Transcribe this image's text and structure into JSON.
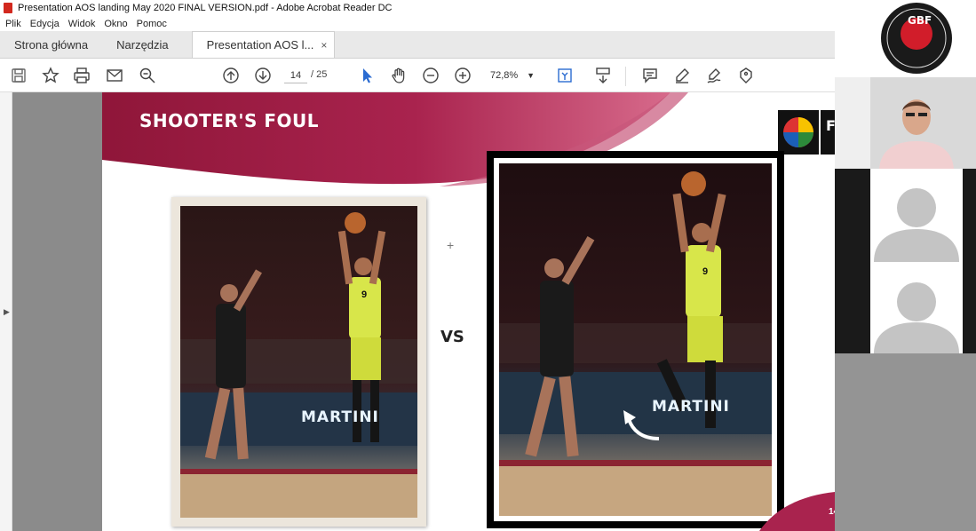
{
  "window": {
    "title": "Presentation AOS  landing May 2020 FINAL VERSION.pdf - Adobe Acrobat Reader DC"
  },
  "menu": [
    "Plik",
    "Edycja",
    "Widok",
    "Okno",
    "Pomoc"
  ],
  "tabs": [
    {
      "label": "Strona główna"
    },
    {
      "label": "Narzędzia"
    },
    {
      "label": "Presentation AOS  l...",
      "active": true,
      "close": "×"
    }
  ],
  "toolbar": {
    "page_current": "14",
    "page_total": "/ 25",
    "zoom": "72,8%",
    "icons": [
      "save-icon",
      "star-icon",
      "print-icon",
      "mail-icon",
      "search-zoom-icon",
      "page-up-icon",
      "page-down-icon",
      "select-arrow-icon",
      "hand-icon",
      "zoom-out-icon",
      "zoom-in-icon",
      "fit-page-icon",
      "scroll-mode-icon",
      "comment-icon",
      "highlight-icon",
      "sign-icon",
      "stamp-icon"
    ]
  },
  "slide": {
    "title": "SHOOTER'S FOUL",
    "vs": "VS",
    "page_number": "14",
    "logo_letter": "F",
    "colors": {
      "banner": "#9b1b43",
      "banner_light": "#c03a64"
    }
  },
  "left_photo": {
    "brand": "MARTINI",
    "jersey_number": "9"
  },
  "right_photo": {
    "brand": "MARTINI",
    "jersey_number": "9"
  },
  "video_panel": {
    "logo_text": "GBF",
    "participants": [
      "presenter-video",
      "participant-placeholder",
      "participant-placeholder"
    ]
  }
}
